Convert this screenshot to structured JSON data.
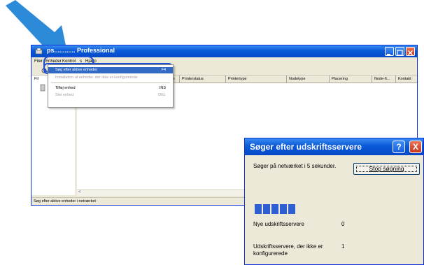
{
  "window": {
    "title": "ps............ Professional",
    "menu": [
      "Filer",
      "Enheder",
      "Kontrol",
      "s",
      "Hjælp"
    ],
    "tree_label": "Fil",
    "status": "Søg efter aktive enheder i netværket",
    "columns": [
      "se",
      "Printerstatus",
      "Printertype",
      "Nodetype",
      "Placering",
      "Node-fi...",
      "Kontakt"
    ]
  },
  "dropdown": {
    "items": [
      {
        "label": "Søg efter aktive enheder",
        "shortcut": "F4",
        "state": "selected"
      },
      {
        "label": "Installation af enheder, der ikke er konfigurerede",
        "shortcut": "",
        "state": "disabled"
      },
      {
        "label": "Tilføj enhed",
        "shortcut": "INS",
        "state": "normal"
      },
      {
        "label": "Slet enhed",
        "shortcut": "DEL",
        "state": "disabled"
      }
    ]
  },
  "dialog": {
    "title": "Søger efter udskriftsservere",
    "message": "Søger på netværket i 5 sekunder.",
    "stop_button": "Stop søgning",
    "progress_blocks": 5,
    "new_servers_label": "Nye udskriftsservere",
    "new_servers_value": "0",
    "unconfigured_label_1": "Udskriftsservere, der ikke er",
    "unconfigured_label_2": "konfigurerede",
    "unconfigured_value": "1",
    "help_glyph": "?",
    "close_glyph": "X"
  },
  "colors": {
    "xp_title_blue": "#0a5ad8",
    "selection_blue": "#316ac5",
    "arrow_blue": "#2c8ad8"
  }
}
